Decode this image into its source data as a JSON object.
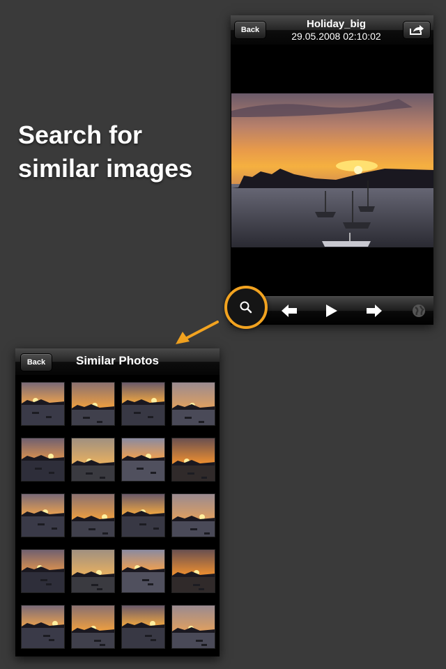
{
  "headline": {
    "line1": "Search for",
    "line2": "similar images"
  },
  "viewer": {
    "back_label": "Back",
    "title": "Holiday_big",
    "timestamp": "29.05.2008 02:10:02",
    "share_icon": "share-icon",
    "toolbar": [
      "search-icon",
      "arrow-left-icon",
      "play-icon",
      "arrow-right-icon",
      "globe-icon"
    ]
  },
  "similar": {
    "back_label": "Back",
    "title": "Similar Photos",
    "thumbnail_count": 20
  },
  "colors": {
    "highlight": "#f2a320",
    "background": "#3a3a3a"
  }
}
